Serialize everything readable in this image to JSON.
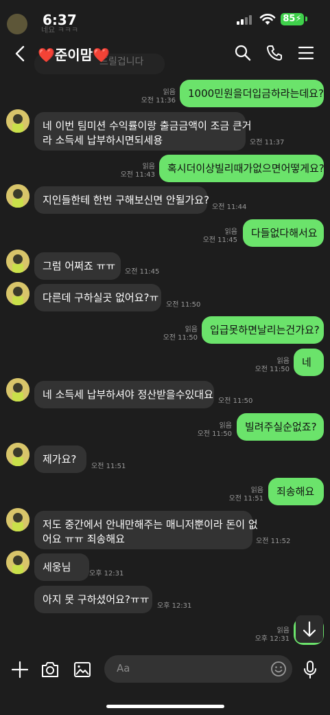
{
  "status_bar": {
    "time": "6:37",
    "battery": "85"
  },
  "header": {
    "title": "❤️준이맘❤️"
  },
  "faded_top": {
    "text1": "네요 ㅋㅋㅋ",
    "text2": "드릴겁니다"
  },
  "messages": [
    {
      "side": "out",
      "text": "1000민원을더입금하라는데요?",
      "read": "읽음",
      "time": "오전 11:36"
    },
    {
      "side": "in",
      "lines": [
        "네 이번 팀미션 수익률이랑 출금금액이 조금 큰거",
        "라 소득세 납부하시면되세용"
      ],
      "time": "오전 11:37"
    },
    {
      "side": "out",
      "text": "혹시더이상빌리때가없으면어떻게요?",
      "read": "읽음",
      "time": "오전 11:43"
    },
    {
      "side": "in",
      "text": "지인들한테 한번 구해보신면 안될가요?",
      "time": "오전 11:44"
    },
    {
      "side": "out",
      "text": "다들없다해서요",
      "read": "읽음",
      "time": "오전 11:45"
    },
    {
      "side": "in",
      "text": "그럼 어쩌죠 ㅠㅠ",
      "time": "오전 11:45"
    },
    {
      "side": "in",
      "text": "다른데 구하실곳 없어요?ㅠ",
      "time": "오전 11:50"
    },
    {
      "side": "out",
      "text": "입급못하면날리는건가요?",
      "read": "읽음",
      "time": "오전 11:50"
    },
    {
      "side": "out",
      "text": "네",
      "read": "읽음",
      "time": "오전 11:50"
    },
    {
      "side": "in",
      "text": "네 소득세 납부하셔야 정산받을수있대요",
      "time": "오전 11:50"
    },
    {
      "side": "out",
      "text": "빌려주실순없죠?",
      "read": "읽음",
      "time": "오전 11:50"
    },
    {
      "side": "in",
      "text": "제가요?",
      "time": "오전 11:51"
    },
    {
      "side": "out",
      "text": "죄송해요",
      "read": "읽음",
      "time": "오전 11:51"
    },
    {
      "side": "in",
      "lines": [
        "저도 중간에서 안내만해주는 매니저뿐이라 돈이 없",
        "어요 ㅠㅠ 죄송해요"
      ],
      "time": "오전 11:52"
    },
    {
      "side": "in",
      "text": "세웅님",
      "time": "오후 12:31"
    },
    {
      "side": "in",
      "text": "아지 못 구하셨어요?ㅠㅠ",
      "time": "오후 12:31"
    },
    {
      "side": "out",
      "text": "",
      "read": "읽음",
      "time": "오후 12:31"
    }
  ],
  "composer": {
    "placeholder": "Aa"
  },
  "icons": [
    "back-icon",
    "search-icon",
    "phone-icon",
    "menu-icon",
    "plus-icon",
    "camera-icon",
    "image-icon",
    "emoji-icon",
    "mic-icon",
    "scroll-down-icon"
  ]
}
